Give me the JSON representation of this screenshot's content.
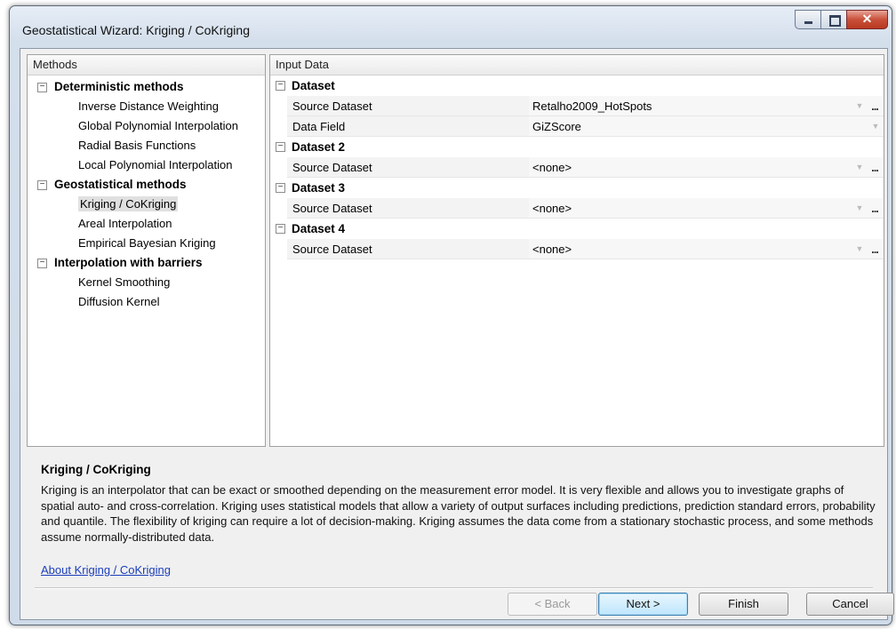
{
  "window": {
    "title": "Geostatistical Wizard: Kriging / CoKriging",
    "minimize_glyph": "",
    "close_glyph": "✕"
  },
  "methods": {
    "header": "Methods",
    "groups": [
      {
        "label": "Deterministic methods",
        "items": [
          "Inverse Distance Weighting",
          "Global Polynomial Interpolation",
          "Radial Basis Functions",
          "Local Polynomial Interpolation"
        ]
      },
      {
        "label": "Geostatistical methods",
        "items": [
          "Kriging / CoKriging",
          "Areal Interpolation",
          "Empirical Bayesian Kriging"
        ]
      },
      {
        "label": "Interpolation with barriers",
        "items": [
          "Kernel Smoothing",
          "Diffusion Kernel"
        ]
      }
    ],
    "selected": "Kriging / CoKriging"
  },
  "input_data": {
    "header": "Input Data",
    "categories": [
      {
        "label": "Dataset",
        "props": [
          {
            "name": "Source Dataset",
            "value": "Retalho2009_HotSpots"
          },
          {
            "name": "Data Field",
            "value": "GiZScore"
          }
        ]
      },
      {
        "label": "Dataset 2",
        "props": [
          {
            "name": "Source Dataset",
            "value": "<none>"
          }
        ]
      },
      {
        "label": "Dataset 3",
        "props": [
          {
            "name": "Source Dataset",
            "value": "<none>"
          }
        ]
      },
      {
        "label": "Dataset 4",
        "props": [
          {
            "name": "Source Dataset",
            "value": "<none>"
          }
        ]
      }
    ],
    "ellipsis": "..."
  },
  "description": {
    "title": "Kriging / CoKriging",
    "text": "Kriging is an interpolator that can be exact or smoothed depending on the measurement error model. It is very flexible and allows you to investigate graphs of spatial auto- and cross-correlation. Kriging uses statistical models that allow a variety of output surfaces including predictions, prediction standard errors, probability and quantile. The flexibility of kriging can require a lot of decision-making. Kriging assumes the data come from a stationary stochastic process, and some methods assume normally-distributed data.",
    "link": "About Kriging / CoKriging"
  },
  "buttons": {
    "back": "< Back",
    "next": "Next >",
    "finish": "Finish",
    "cancel": "Cancel"
  }
}
